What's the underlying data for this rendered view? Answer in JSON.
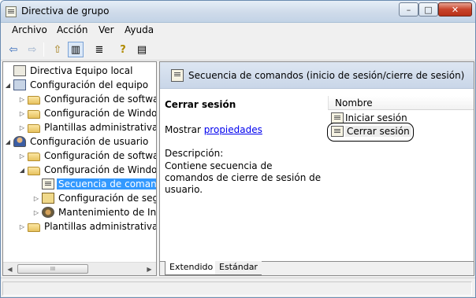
{
  "window": {
    "title": "Directiva de grupo",
    "title_icon": "scroll-icon",
    "controls": {
      "minimize": "–",
      "maximize": "□",
      "close": "✕"
    }
  },
  "menu": [
    "Archivo",
    "Acción",
    "Ver",
    "Ayuda"
  ],
  "toolbar": [
    {
      "icon": "back-arrow-icon",
      "glyph": "⇦"
    },
    {
      "icon": "forward-arrow-icon",
      "glyph": "⇨"
    },
    {
      "icon": "up-folder-icon",
      "glyph": "⇧"
    },
    {
      "icon": "show-hide-tree-icon",
      "glyph": "▥"
    },
    {
      "icon": "export-list-icon",
      "glyph": "≣"
    },
    {
      "icon": "help-icon",
      "glyph": "?"
    },
    {
      "icon": "properties-icon",
      "glyph": "▤"
    }
  ],
  "tree": [
    {
      "label": "Directiva Equipo local",
      "icon": "book-icon",
      "level": 0,
      "expander": ""
    },
    {
      "label": "Configuración del equipo",
      "icon": "computer-icon",
      "level": 1,
      "expander": "◢"
    },
    {
      "label": "Configuración de software",
      "icon": "folder-icon",
      "level": 2,
      "expander": "▷"
    },
    {
      "label": "Configuración de Windows",
      "icon": "folder-icon",
      "level": 2,
      "expander": "▷"
    },
    {
      "label": "Plantillas administrativas",
      "icon": "folder-icon",
      "level": 2,
      "expander": "▷"
    },
    {
      "label": "Configuración de usuario",
      "icon": "user-icon",
      "level": 1,
      "expander": "◢"
    },
    {
      "label": "Configuración de software",
      "icon": "folder-icon",
      "level": 2,
      "expander": "▷"
    },
    {
      "label": "Configuración de Windows",
      "icon": "folder-icon",
      "level": 2,
      "expander": "◢"
    },
    {
      "label": "Secuencia de comandos (inicio de sesión/cierre de sesión)",
      "icon": "script-icon",
      "level": 3,
      "expander": "",
      "selected": true
    },
    {
      "label": "Configuración de seguridad",
      "icon": "security-icon",
      "level": 3,
      "expander": "▷"
    },
    {
      "label": "Mantenimiento de Internet Explorer",
      "icon": "gear-icon",
      "level": 3,
      "expander": "▷"
    },
    {
      "label": "Plantillas administrativas",
      "icon": "folder-icon",
      "level": 2,
      "expander": "▷"
    }
  ],
  "hscroll_thumb_label": "III",
  "right_header": "Secuencia de comandos (inicio de sesión/cierre de sesión)",
  "detail": {
    "title": "Cerrar sesión",
    "show_prefix": "Mostrar ",
    "show_link": "propiedades",
    "desc_label": "Descripción:",
    "desc_text": "Contiene secuencia de comandos de cierre de sesión de usuario."
  },
  "list": {
    "column": "Nombre",
    "items": [
      "Iniciar sesión",
      "Cerrar sesión"
    ]
  },
  "tabs": [
    "Extendido",
    "Estándar"
  ]
}
